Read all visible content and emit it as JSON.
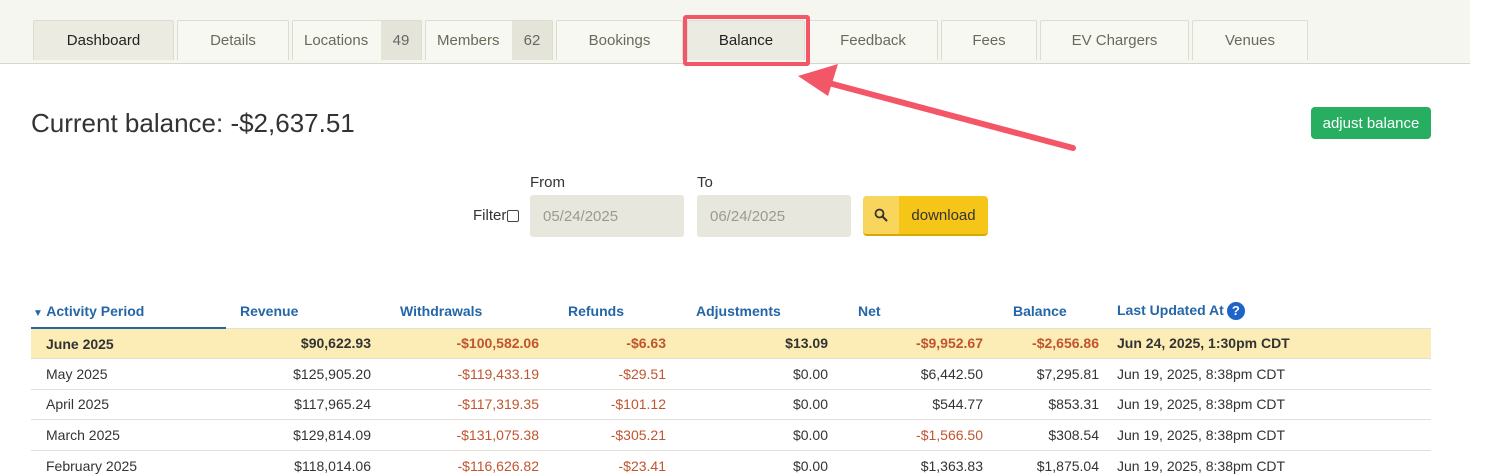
{
  "tabs": [
    {
      "label": "Dashboard",
      "count": ""
    },
    {
      "label": "Details",
      "count": ""
    },
    {
      "label": "Locations",
      "count": "49"
    },
    {
      "label": "Members",
      "count": "62"
    },
    {
      "label": "Bookings",
      "count": ""
    },
    {
      "label": "Balance",
      "count": ""
    },
    {
      "label": "Feedback",
      "count": ""
    },
    {
      "label": "Fees",
      "count": ""
    },
    {
      "label": "EV Chargers",
      "count": ""
    },
    {
      "label": "Venues",
      "count": ""
    }
  ],
  "page": {
    "title": "Current balance: -$2,637.51",
    "adjust_label": "adjust balance"
  },
  "filter": {
    "label": "Filter",
    "from_label": "From",
    "to_label": "To",
    "from_value": "05/24/2025",
    "to_value": "06/24/2025",
    "download_label": "download"
  },
  "table": {
    "headers": [
      "Activity Period",
      "Revenue",
      "Withdrawals",
      "Refunds",
      "Adjustments",
      "Net",
      "Balance",
      "Last Updated At"
    ],
    "help_icon": "?",
    "rows": [
      [
        "June 2025",
        "$90,622.93",
        "-$100,582.06",
        "-$6.63",
        "$13.09",
        "-$9,952.67",
        "-$2,656.86",
        "Jun 24, 2025, 1:30pm CDT"
      ],
      [
        "May 2025",
        "$125,905.20",
        "-$119,433.19",
        "-$29.51",
        "$0.00",
        "$6,442.50",
        "$7,295.81",
        "Jun 19, 2025, 8:38pm CDT"
      ],
      [
        "April 2025",
        "$117,965.24",
        "-$117,319.35",
        "-$101.12",
        "$0.00",
        "$544.77",
        "$853.31",
        "Jun 19, 2025, 8:38pm CDT"
      ],
      [
        "March 2025",
        "$129,814.09",
        "-$131,075.38",
        "-$305.21",
        "$0.00",
        "-$1,566.50",
        "$308.54",
        "Jun 19, 2025, 8:38pm CDT"
      ],
      [
        "February 2025",
        "$118,014.06",
        "-$116,626.82",
        "-$23.41",
        "$0.00",
        "$1,363.83",
        "$1,875.04",
        "Jun 19, 2025, 8:38pm CDT"
      ]
    ]
  },
  "colors": {
    "accent_green": "#27ae60",
    "download_yellow": "#f5c518",
    "highlight_red": "#f25667",
    "negative": "#c0552f",
    "link_blue": "#2466a8"
  }
}
